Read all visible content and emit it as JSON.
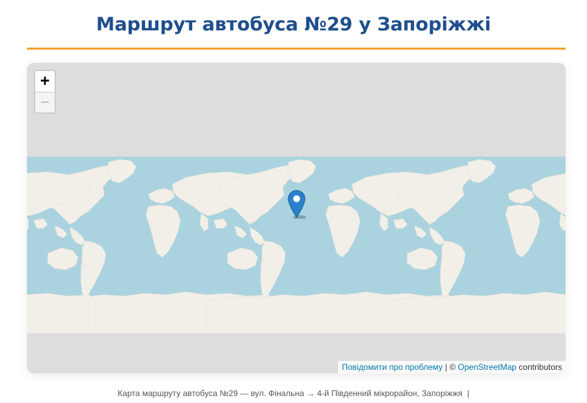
{
  "page": {
    "title": "Маршрут автобуса №29 у Запоріжжі",
    "accent_color": "#f0a430",
    "title_color": "#1f4e8c"
  },
  "map": {
    "zoom_in_label": "+",
    "zoom_out_label": "−",
    "marker_icon": "map-pin-icon",
    "marker_color": "#2a81cb",
    "ocean_color": "#aad3df",
    "land_color": "#f2efe9",
    "background_color": "#dddddd",
    "attribution": {
      "report_link": "Повідомити про проблему",
      "separator": " | © ",
      "osm_link": "OpenStreetMap",
      "suffix": " contributors"
    }
  },
  "footer": {
    "caption": "Карта маршруту автобуса №29 — вул. Фінальна → 4-й Південний мікрорайон, Запоріжжя  |"
  }
}
